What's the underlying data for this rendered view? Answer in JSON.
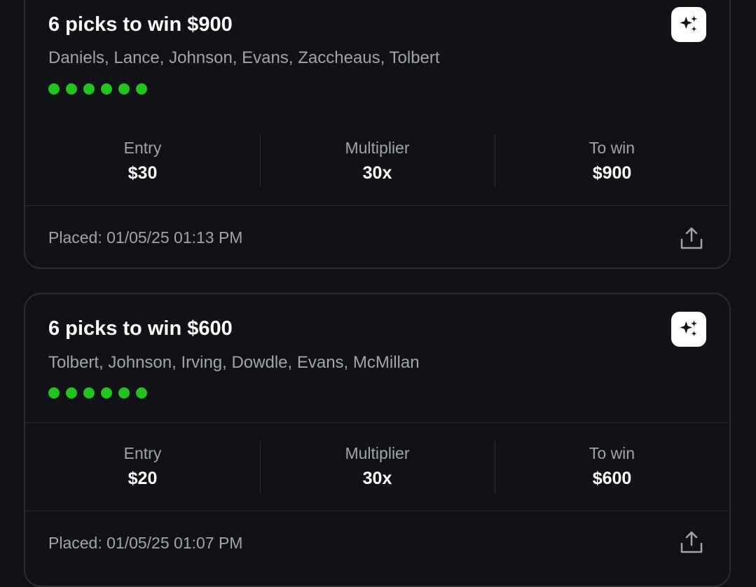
{
  "entries": [
    {
      "title": "6 picks to win $900",
      "players": "Daniels, Lance, Johnson, Evans, Zaccheaus, Tolbert",
      "pick_count": 6,
      "pick_status_color": "#22c21f",
      "stats": {
        "entry_label": "Entry",
        "entry_value": "$30",
        "multiplier_label": "Multiplier",
        "multiplier_value": "30x",
        "to_win_label": "To win",
        "to_win_value": "$900"
      },
      "placed": "Placed: 01/05/25 01:13 PM",
      "ai_icon": "sparkles-icon",
      "share_icon": "share-icon"
    },
    {
      "title": "6 picks to win $600",
      "players": "Tolbert, Johnson, Irving, Dowdle, Evans, McMillan",
      "pick_count": 6,
      "pick_status_color": "#22c21f",
      "stats": {
        "entry_label": "Entry",
        "entry_value": "$20",
        "multiplier_label": "Multiplier",
        "multiplier_value": "30x",
        "to_win_label": "To win",
        "to_win_value": "$600"
      },
      "placed": "Placed: 01/05/25 01:07 PM",
      "ai_icon": "sparkles-icon",
      "share_icon": "share-icon"
    }
  ],
  "colors": {
    "background": "#111216",
    "border": "#2b2d33",
    "muted_text": "#a1a4ad",
    "primary_text": "#ffffff"
  }
}
